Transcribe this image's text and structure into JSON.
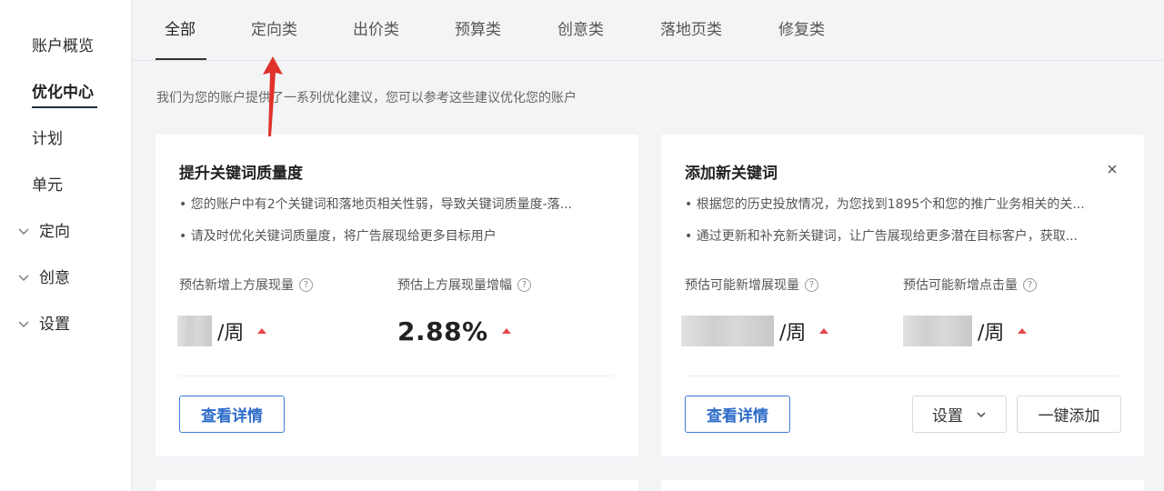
{
  "sidebar": {
    "items": [
      {
        "label": "账户概览"
      },
      {
        "label": "优化中心"
      },
      {
        "label": "计划"
      },
      {
        "label": "单元"
      },
      {
        "label": "定向"
      },
      {
        "label": "创意"
      },
      {
        "label": "设置"
      }
    ]
  },
  "tabs": [
    {
      "label": "全部"
    },
    {
      "label": "定向类"
    },
    {
      "label": "出价类"
    },
    {
      "label": "预算类"
    },
    {
      "label": "创意类"
    },
    {
      "label": "落地页类"
    },
    {
      "label": "修复类"
    }
  ],
  "hint": "我们为您的账户提供了一系列优化建议，您可以参考这些建议优化您的账户",
  "cards": [
    {
      "title": "提升关键词质量度",
      "bullets": [
        "• 您的账户中有2个关键词和落地页相关性弱，导致关键词质量度-落...",
        "• 请及时优化关键词质量度，将广告展现给更多目标用户"
      ],
      "metrics": [
        {
          "label": "预估新增上方展现量",
          "value": "/周"
        },
        {
          "label": "预估上方展现量增幅",
          "value": "2.88%"
        }
      ],
      "detail_button": "查看详情"
    },
    {
      "title": "添加新关键词",
      "bullets": [
        "• 根据您的历史投放情况，为您找到1895个和您的推广业务相关的关...",
        "• 通过更新和补充新关键词，让广告展现给更多潜在目标客户，获取..."
      ],
      "metrics": [
        {
          "label": "预估可能新增展现量",
          "value": "/周"
        },
        {
          "label": "预估可能新增点击量",
          "value": "/周"
        }
      ],
      "detail_button": "查看详情",
      "settings_button": "设置",
      "add_button": "一键添加"
    }
  ],
  "colors": {
    "accent": "#3c7bd8",
    "up_arrow": "#e5484d",
    "annotation": "#e0312b"
  }
}
